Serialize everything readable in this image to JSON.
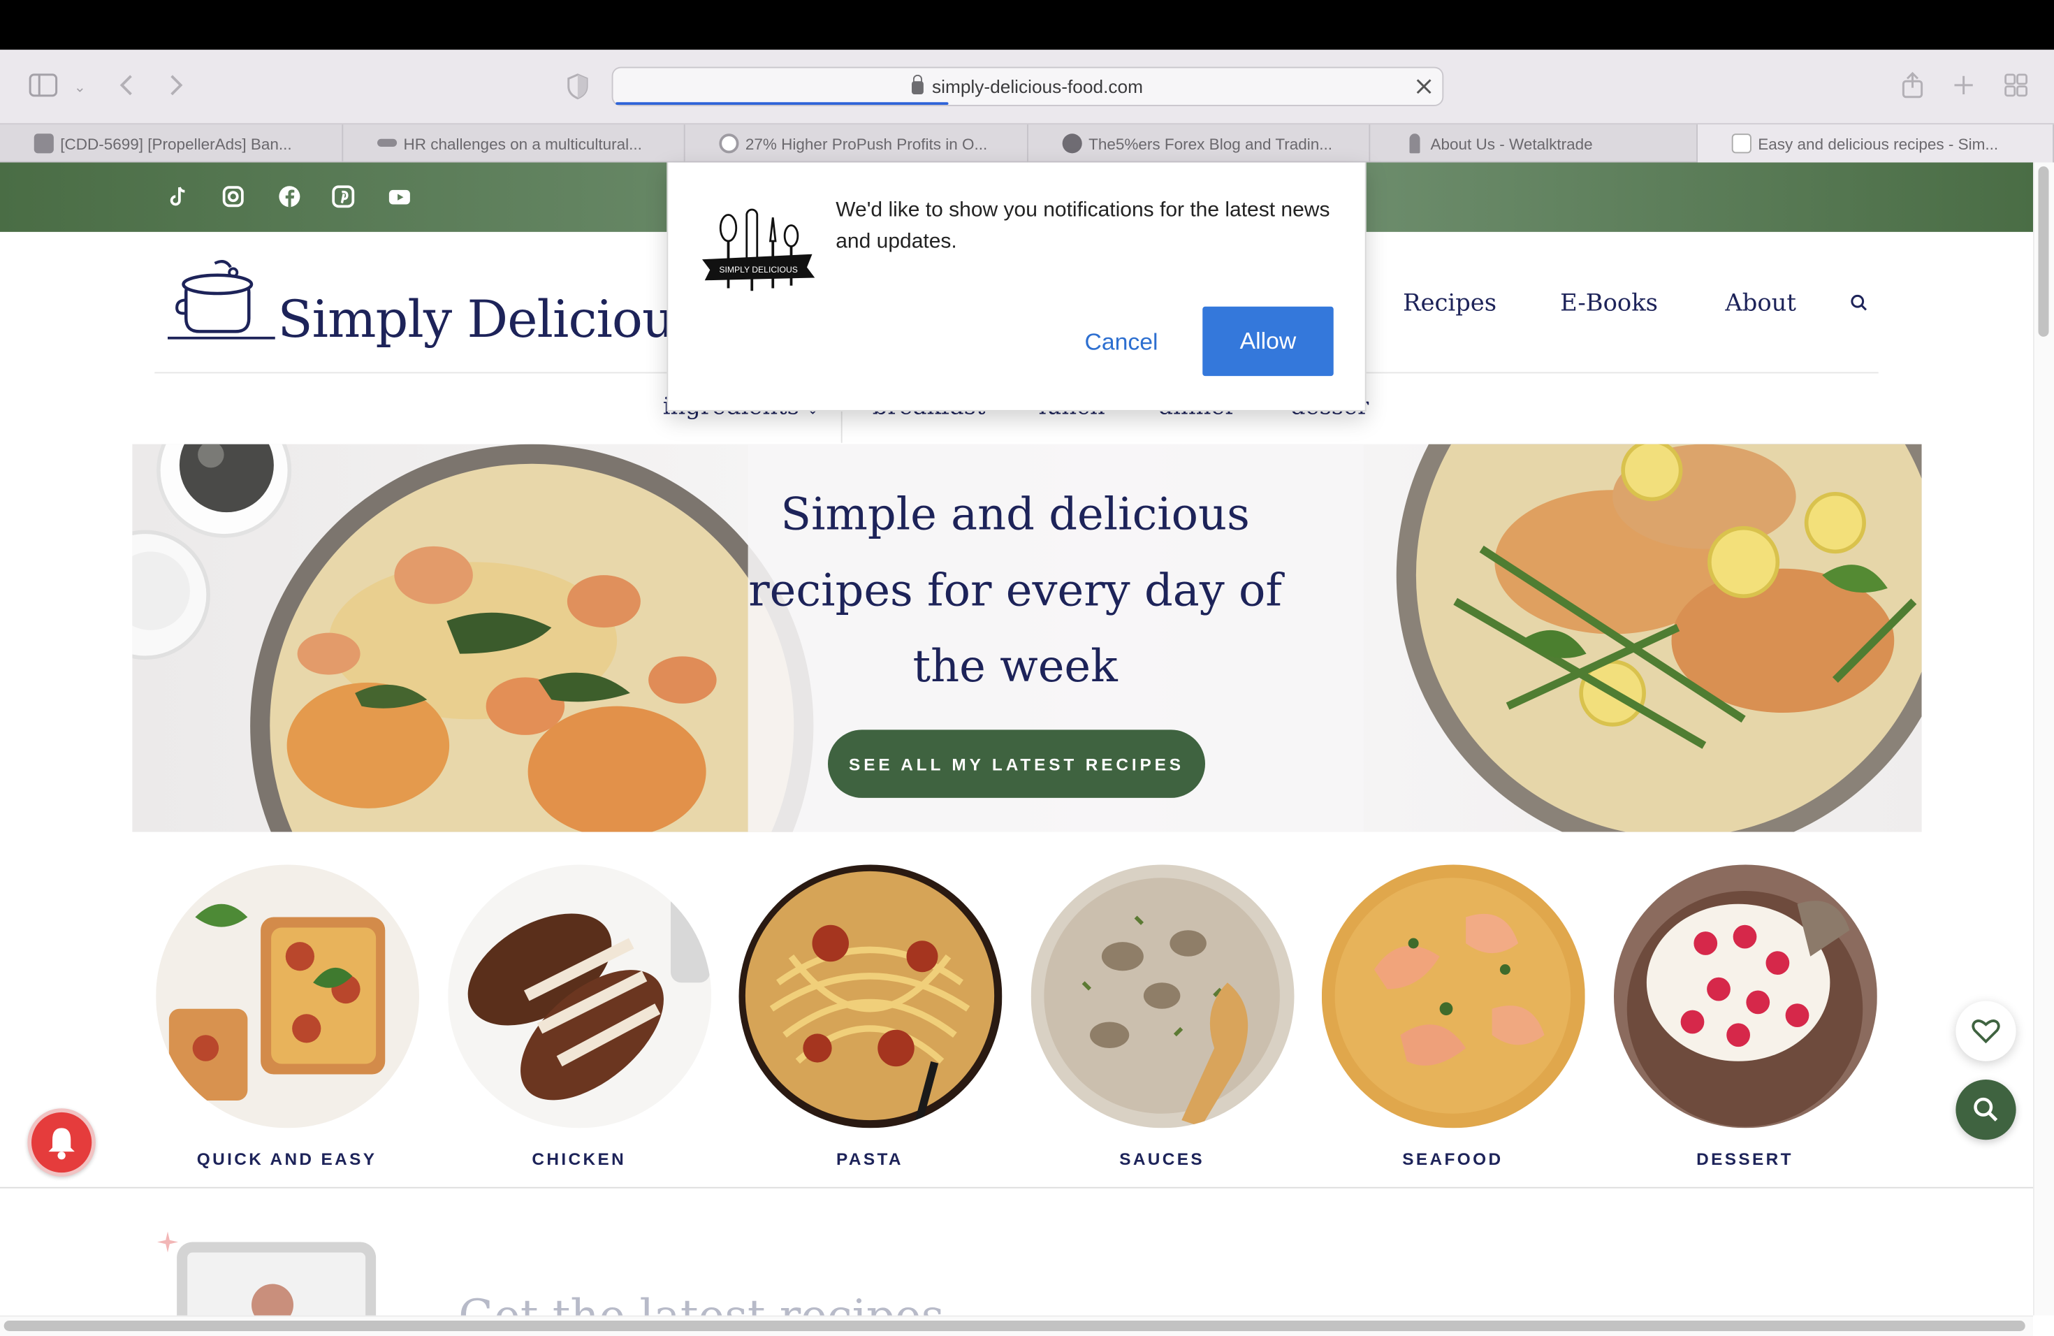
{
  "browser": {
    "url": "simply-delicious-food.com",
    "tabs": [
      {
        "title": "[CDD-5699] [PropellerAds] Ban...",
        "active": false
      },
      {
        "title": "HR challenges on a multicultural...",
        "active": false
      },
      {
        "title": "27% Higher ProPush Profits in O...",
        "active": false
      },
      {
        "title": "The5%ers Forex Blog and Tradin...",
        "active": false
      },
      {
        "title": "About Us - Wetalktrade",
        "active": false
      },
      {
        "title": "Easy and delicious recipes - Sim...",
        "active": true
      }
    ]
  },
  "site": {
    "logo_text": "Simply Delicious",
    "nav": [
      "Recipes",
      "E-Books",
      "About"
    ],
    "subnav": [
      "ingredients",
      "breakfast",
      "lunch",
      "dinner",
      "dessert"
    ],
    "hero_title": "Simple and delicious recipes for every day of the week",
    "hero_button": "SEE ALL MY LATEST RECIPES",
    "categories": [
      "QUICK AND EASY",
      "CHICKEN",
      "PASTA",
      "SAUCES",
      "SEAFOOD",
      "DESSERT"
    ],
    "peek_title": "Get the latest recipes"
  },
  "popup": {
    "logo_text": "SIMPLY DELICIOUS",
    "message": "We'd like to show you notifications for the latest news and updates.",
    "cancel": "Cancel",
    "allow": "Allow"
  },
  "colors": {
    "brand_navy": "#1d2359",
    "brand_green": "#3f6340",
    "allow_blue": "#3478db",
    "bell_red": "#e53c3c"
  }
}
